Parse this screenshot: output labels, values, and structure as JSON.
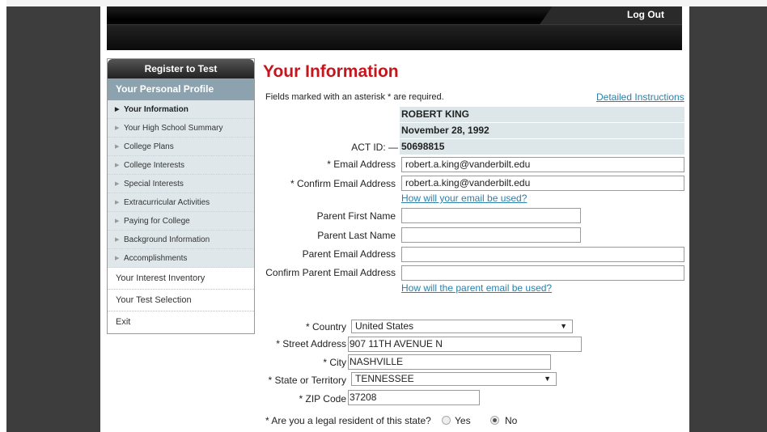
{
  "header": {
    "logout_label": "Log Out"
  },
  "sidebar": {
    "header": "Register to Test",
    "profile_label": "Your Personal Profile",
    "sub_items": [
      {
        "label": "Your Information"
      },
      {
        "label": "Your High School Summary"
      },
      {
        "label": "College Plans"
      },
      {
        "label": "College Interests"
      },
      {
        "label": "Special Interests"
      },
      {
        "label": "Extracurricular Activities"
      },
      {
        "label": "Paying for College"
      },
      {
        "label": "Background Information"
      },
      {
        "label": "Accomplishments"
      }
    ],
    "top_items": [
      {
        "label": "Your Interest Inventory"
      },
      {
        "label": "Your Test Selection"
      },
      {
        "label": "Exit"
      }
    ]
  },
  "main": {
    "title": "Your Information",
    "required_note": "Fields marked with an asterisk * are required.",
    "instructions_link": "Detailed Instructions",
    "name": "ROBERT KING",
    "birthdate": "November 28, 1992",
    "act_id_label": "ACT ID: —",
    "act_id": "50698815",
    "email_label": "* Email Address",
    "email_value": "robert.a.king@vanderbilt.edu",
    "confirm_email_label": "* Confirm Email Address",
    "confirm_email_value": "robert.a.king@vanderbilt.edu",
    "email_help_link": "How will your email be used?",
    "parent_first_label": "Parent First Name",
    "parent_first_value": "",
    "parent_last_label": "Parent Last Name",
    "parent_last_value": "",
    "parent_email_label": "Parent Email Address",
    "parent_email_value": "",
    "parent_confirm_label": "Confirm Parent Email Address",
    "parent_confirm_value": "",
    "parent_email_help_link": "How will the parent email be used?",
    "country_label": "* Country",
    "country_value": "United States",
    "street_label": "* Street Address",
    "street_value": "907 11TH AVENUE N",
    "city_label": "* City",
    "city_value": "NASHVILLE",
    "state_label": "* State or Territory",
    "state_value": "TENNESSEE",
    "zip_label": "* ZIP Code",
    "zip_value": "37208",
    "resident_question": "* Are you a legal resident of this state?",
    "resident_yes": "Yes",
    "resident_no": "No",
    "resident_selected": "No"
  },
  "colors": {
    "title": "#c4161c",
    "link": "#2c7fa8",
    "profile_bar": "#8ca3af",
    "shade": "#dde7ea"
  },
  "icons": {
    "dropdown": "triangle-down-icon",
    "nav_marker": "triangle-right-icon"
  }
}
